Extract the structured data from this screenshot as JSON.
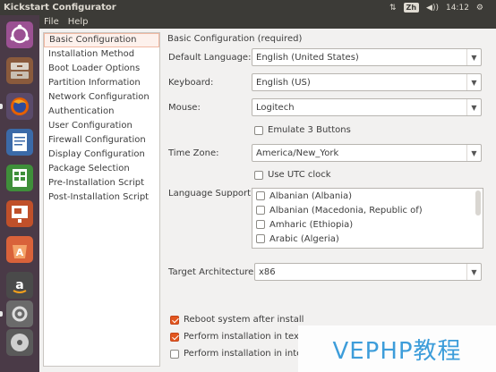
{
  "window": {
    "title": "Kickstart Configurator"
  },
  "indicators": {
    "network": "⇅",
    "keyboard": "Zh",
    "volume": "◀))",
    "time": "14:12",
    "settings": "⚙"
  },
  "menu": [
    "File",
    "Help"
  ],
  "launcher": [
    {
      "icon": "ubuntu-logo-icon",
      "color": "#9b5193"
    },
    {
      "icon": "file-manager-icon",
      "color": "#8a5a3c"
    },
    {
      "icon": "firefox-icon",
      "color": "#5a4a6a"
    },
    {
      "icon": "writer-icon",
      "color": "#4a5a6a"
    },
    {
      "icon": "calc-icon",
      "color": "#4a6a4a"
    },
    {
      "icon": "impress-icon",
      "color": "#6a4a3c"
    },
    {
      "icon": "software-center-icon",
      "color": "#6a4a3c"
    },
    {
      "icon": "amazon-icon",
      "color": "#4a4a4a"
    },
    {
      "icon": "system-settings-icon",
      "color": "#6a6a6a"
    },
    {
      "icon": "kickstart-icon",
      "color": "#7a7a7a"
    },
    {
      "icon": "dvd-icon",
      "color": "#5a5a5a"
    }
  ],
  "nav": [
    "Basic Configuration",
    "Installation Method",
    "Boot Loader Options",
    "Partition Information",
    "Network Configuration",
    "Authentication",
    "User Configuration",
    "Firewall Configuration",
    "Display Configuration",
    "Package Selection",
    "Pre-Installation Script",
    "Post-Installation Script"
  ],
  "selected_nav": 0,
  "form": {
    "section_title": "Basic Configuration (required)",
    "default_language_label": "Default Language:",
    "default_language_value": "English (United States)",
    "keyboard_label": "Keyboard:",
    "keyboard_value": "English (US)",
    "mouse_label": "Mouse:",
    "mouse_value": "Logitech",
    "emulate_label": "Emulate 3 Buttons",
    "emulate_checked": false,
    "timezone_label": "Time Zone:",
    "timezone_value": "America/New_York",
    "utc_label": "Use UTC clock",
    "utc_checked": false,
    "language_support_label": "Language Support:",
    "languages": [
      "Albanian (Albania)",
      "Albanian (Macedonia, Republic of)",
      "Amharic (Ethiopia)",
      "Arabic (Algeria)"
    ],
    "target_arch_label": "Target Architecture:",
    "target_arch_value": "x86",
    "reboot_label": "Reboot system after install",
    "reboot_checked": true,
    "text_mode_label": "Perform installation in text",
    "text_mode_checked": true,
    "interactive_label": "Perform installation in inte",
    "interactive_checked": false
  },
  "watermark": "VEPHP教程"
}
